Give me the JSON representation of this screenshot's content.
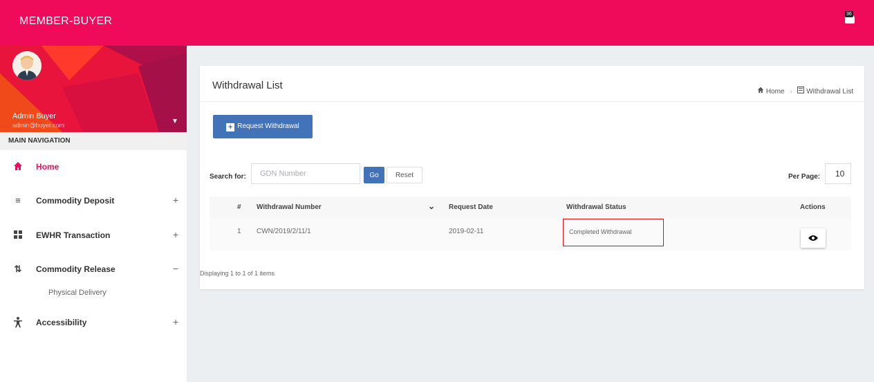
{
  "app": {
    "title": "MEMBER-BUYER",
    "notification_count": "36"
  },
  "user": {
    "name": "Admin Buyer",
    "email": "admin@buyer.com"
  },
  "nav": {
    "header": "MAIN NAVIGATION",
    "items": [
      {
        "label": "Home",
        "icon": "home-icon",
        "toggle": ""
      },
      {
        "label": "Commodity Deposit",
        "icon": "list-icon",
        "toggle": "+"
      },
      {
        "label": "EWHR Transaction",
        "icon": "transfer-icon",
        "toggle": "+"
      },
      {
        "label": "Commodity Release",
        "icon": "sort-icon",
        "toggle": "−"
      },
      {
        "label": "Accessibility",
        "icon": "accessibility-icon",
        "toggle": "+"
      }
    ],
    "subitem": "Physical Delivery"
  },
  "page": {
    "title": "Withdrawal List",
    "breadcrumb": {
      "home": "Home",
      "current": "Withdrawal List"
    },
    "request_button": "Request Withdrawal",
    "search": {
      "label": "Search for:",
      "placeholder": "GDN Number",
      "go": "Go",
      "reset": "Reset"
    },
    "per_page": {
      "label": "Per Page:",
      "value": "10"
    },
    "table": {
      "headers": [
        "#",
        "Withdrawal Number",
        "Request Date",
        "Withdrawal Status",
        "Actions"
      ],
      "rows": [
        {
          "index": "1",
          "number": "CWN/2019/2/11/1",
          "date": "2019-02-11",
          "status": "Completed Withdrawal"
        }
      ]
    },
    "footer": "Displaying 1 to 1 of 1 items"
  },
  "colors": {
    "brand": "#ef0a5a",
    "button": "#4272b8",
    "highlight": "#dd1111"
  }
}
